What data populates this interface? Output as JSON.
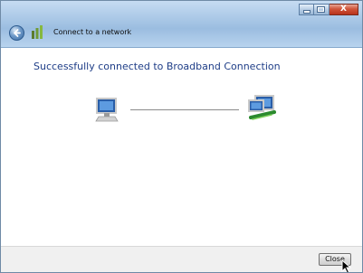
{
  "window": {
    "title": "Connect to a network",
    "controls": {
      "close_glyph": "X"
    }
  },
  "main": {
    "headline": "Successfully connected to Broadband Connection"
  },
  "footer": {
    "close_label": "Close"
  },
  "icons": {
    "back": "back-arrow-icon",
    "network": "network-icon",
    "left_computer": "computer-icon",
    "right_network": "network-computers-icon"
  },
  "colors": {
    "headline": "#1e3d87",
    "titlebar": "#a9c7e6",
    "close_control": "#c94a2f"
  }
}
